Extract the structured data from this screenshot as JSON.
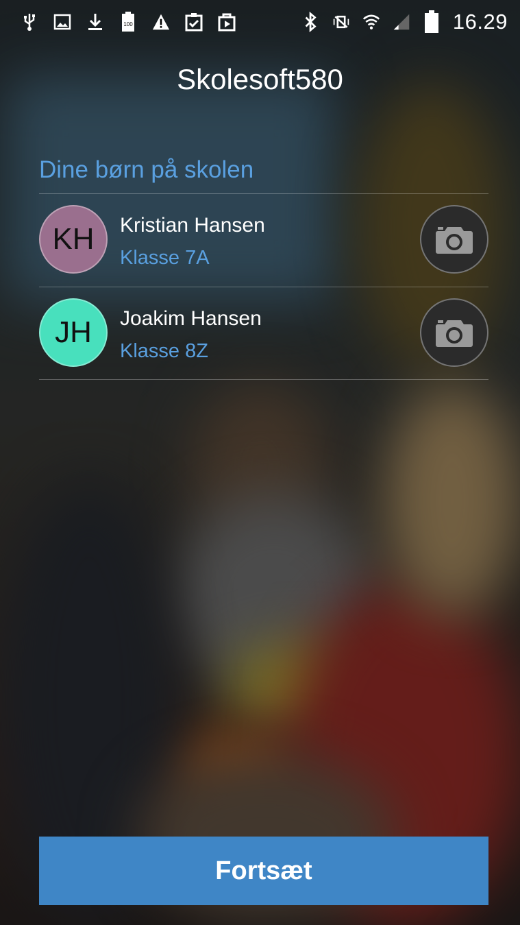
{
  "status_bar": {
    "time": "16.29",
    "left_icons": [
      "usb-icon",
      "image-icon",
      "download-icon",
      "battery-saver-icon",
      "warning-icon",
      "clipboard-check-icon",
      "play-store-icon"
    ],
    "right_icons": [
      "bluetooth-icon",
      "vibrate-icon",
      "wifi-icon",
      "signal-icon",
      "battery-icon"
    ],
    "battery_label": "100"
  },
  "app": {
    "title": "Skolesoft580"
  },
  "children_section": {
    "label": "Dine børn på skolen",
    "children": [
      {
        "initials": "KH",
        "name": "Kristian Hansen",
        "class": "Klasse 7A",
        "avatar_color": "#9a6f8e"
      },
      {
        "initials": "JH",
        "name": "Joakim Hansen",
        "class": "Klasse 8Z",
        "avatar_color": "#48e0bd"
      }
    ]
  },
  "actions": {
    "continue_label": "Fortsæt"
  },
  "colors": {
    "accent": "#5aa0e0",
    "button": "#3f86c6"
  }
}
